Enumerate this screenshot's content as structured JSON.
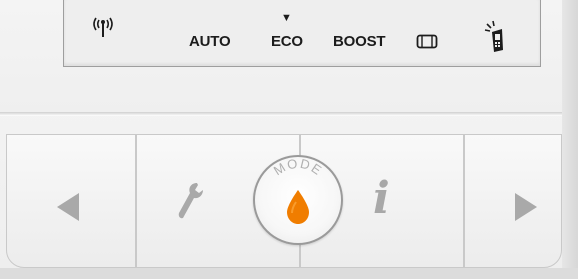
{
  "display": {
    "modes": {
      "auto": "AUTO",
      "eco": "ECO",
      "boost": "BOOST"
    },
    "selected_mode": "ECO",
    "icons": {
      "signal": "wireless-signal-icon",
      "selector": "triangle-down-icon",
      "holiday": "suitcase-icon",
      "status": "phone-light-icon"
    }
  },
  "keypad": {
    "mode_label": "MODE",
    "icons": {
      "left": "arrow-left-icon",
      "settings": "wrench-icon",
      "mode_drop": "drop-icon",
      "info": "info-icon",
      "right": "arrow-right-icon"
    },
    "info_glyph": "i"
  },
  "colors": {
    "drop": "#f07d00",
    "lcd_text": "#1c1c1c",
    "key_icon": "#a9a9a9"
  }
}
